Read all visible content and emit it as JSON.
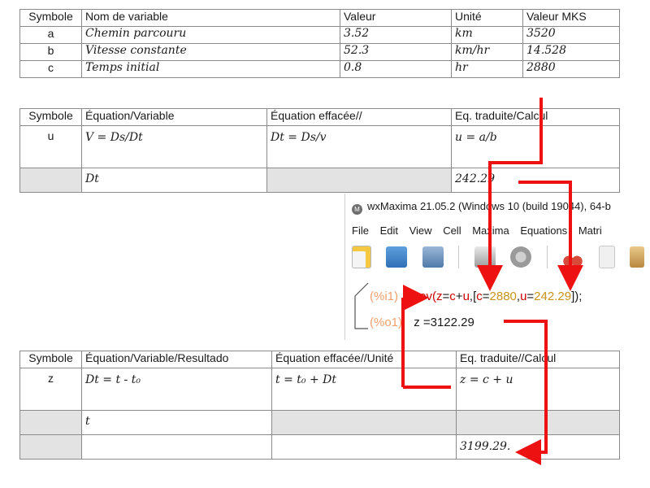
{
  "table1": {
    "headers": [
      "Symbole",
      "Nom de variable",
      "Valeur",
      "Unité",
      "Valeur MKS"
    ],
    "rows": [
      {
        "sym": "a",
        "name": "Chemin parcouru",
        "value": "3.52",
        "unit": "km",
        "mks": "3520"
      },
      {
        "sym": "b",
        "name": "Vitesse constante",
        "value": "52.3",
        "unit": "km/hr",
        "mks": "14.528"
      },
      {
        "sym": "c",
        "name": "Temps initial",
        "value": "0.8",
        "unit": "hr",
        "mks": "2880"
      }
    ]
  },
  "table2": {
    "headers": [
      "Symbole",
      "Équation/Variable",
      "Équation effacée//",
      "Eq. traduite/Calcul"
    ],
    "row1": {
      "sym": "u",
      "eq": "V = Ds/Dt",
      "erased": "Dt = Ds/v",
      "translated": "u = a/b"
    },
    "row2": {
      "eq": "Dt",
      "calc": "242.29"
    }
  },
  "wxmaxima": {
    "title": "wxMaxima 21.05.2 (Windows 10 (build 19044), 64-b",
    "menu": [
      "File",
      "Edit",
      "View",
      "Cell",
      "Maxima",
      "Equations",
      "Matri"
    ],
    "input_label": "(%i1)",
    "input_fn": "ev(",
    "input_z": "z",
    "input_eq": "=",
    "input_c": "c",
    "input_plus": "+",
    "input_u": "u",
    "input_open": ",[",
    "input_c2": "c",
    "input_eq2": "=",
    "input_v1": "2880",
    "input_comma": ",",
    "input_u2": "u",
    "input_eq3": "=",
    "input_v2": "242.29",
    "input_close": "]);",
    "output_label": "(%o1)",
    "output_value": "z =3122.29"
  },
  "table3": {
    "headers": [
      "Symbole",
      "Équation/Variable/Resultado",
      "Équation effacée//Unité",
      "Eq. traduite//Calcul"
    ],
    "row1": {
      "sym": "z",
      "eq": "Dt = t - t₀",
      "erased": "t = t₀ + Dt",
      "translated": "z = c + u"
    },
    "row2": {
      "eq": "t"
    },
    "row3": {
      "calc": "3199.29."
    }
  },
  "colors": {
    "arrow": "#ee1111",
    "handwriting": "#3b49c9"
  }
}
